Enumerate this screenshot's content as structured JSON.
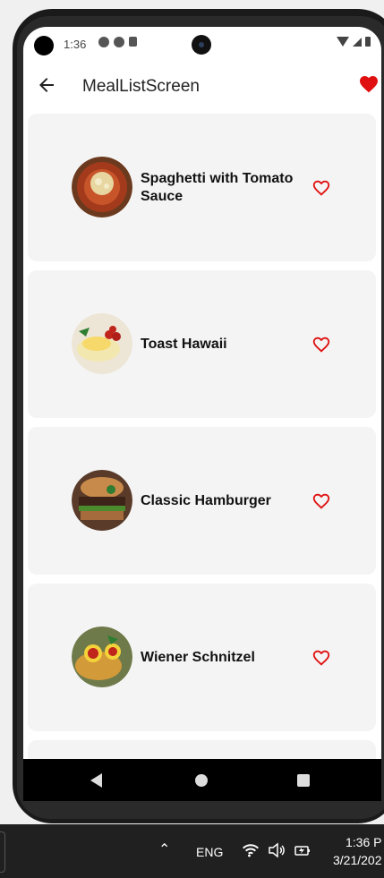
{
  "status_bar": {
    "time": "1:36"
  },
  "app_bar": {
    "title": "MealListScreen"
  },
  "meals": [
    {
      "name": "Spaghetti with Tomato Sauce",
      "favorite": false
    },
    {
      "name": "Toast Hawaii",
      "favorite": false
    },
    {
      "name": "Classic Hamburger",
      "favorite": false
    },
    {
      "name": "Wiener Schnitzel",
      "favorite": false
    }
  ],
  "taskbar": {
    "language": "ENG",
    "time": "1:36 P",
    "date": "3/21/202"
  },
  "colors": {
    "accent": "#e01010",
    "card_bg": "#f4f4f4"
  }
}
